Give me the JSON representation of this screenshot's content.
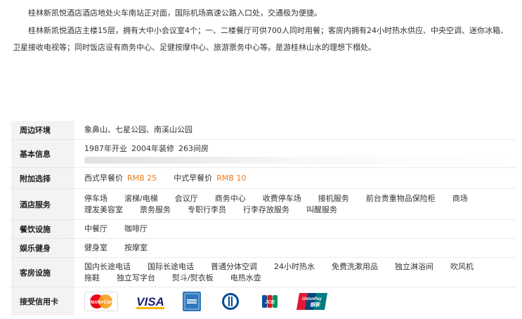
{
  "intro": {
    "para1": "桂林新凯悦酒店酒店地处火车南站正对面，国际机场高速公路入口处，交通极为便捷。",
    "para2": "桂林新凯悦酒店主楼15层，拥有大中小会议室4个；一、二楼餐厅可供700人同时用餐；客房内拥有24小时热水供应、中央空调、迷你冰箱、卫星接收电视等；同时饭店设有商务中心、足健按摩中心、旅游票务中心等。是游桂林山水的理想下榻处。"
  },
  "info": {
    "surroundings": {
      "label": "周边环境",
      "items": [
        "象鼻山、七星公园、南溪山公园"
      ]
    },
    "basic": {
      "label": "基本信息",
      "items": [
        "1987年开业",
        "2004年装修",
        "263间房"
      ]
    },
    "extras": {
      "label": "附加选择",
      "western_label": "西式早餐价",
      "western_price": "RMB 25",
      "chinese_label": "中式早餐价",
      "chinese_price": "RMB 10"
    },
    "hotel_services": {
      "label": "酒店服务",
      "items": [
        "停车场",
        "滚梯/电梯",
        "会议厅",
        "商务中心",
        "收费停车场",
        "接机服务",
        "前台贵重物品保险柜",
        "商场",
        "理发美容室",
        "票务服务",
        "专职行李员",
        "行李存放服务",
        "叫醒服务"
      ]
    },
    "dining": {
      "label": "餐饮设施",
      "items": [
        "中餐厅",
        "咖啡厅"
      ]
    },
    "fitness": {
      "label": "娱乐健身",
      "items": [
        "健身室",
        "按摩室"
      ]
    },
    "room": {
      "label": "客房设施",
      "items": [
        "国内长途电话",
        "国际长途电话",
        "普通分体空调",
        "24小时热水",
        "免费洗漱用品",
        "独立淋浴间",
        "吹风机",
        "拖鞋",
        "独立写字台",
        "熨斗/熨衣板",
        "电热水壶"
      ]
    },
    "cards": {
      "label": "接受信用卡",
      "items": [
        "MasterCard",
        "VISA",
        "American Express",
        "Diners Club",
        "JCB",
        "UnionPay"
      ],
      "colors": {
        "mastercard_red": "#eb001b",
        "mastercard_orange": "#f79e1b",
        "visa_blue": "#1a1f71",
        "amex_blue": "#2e77bb",
        "diners_blue": "#004a97",
        "jcb_red": "#d71920",
        "unionpay_red": "#e21836"
      }
    }
  },
  "colors": {
    "price_accent": "#e87c1e",
    "label_bg": "#f3f3f3"
  }
}
